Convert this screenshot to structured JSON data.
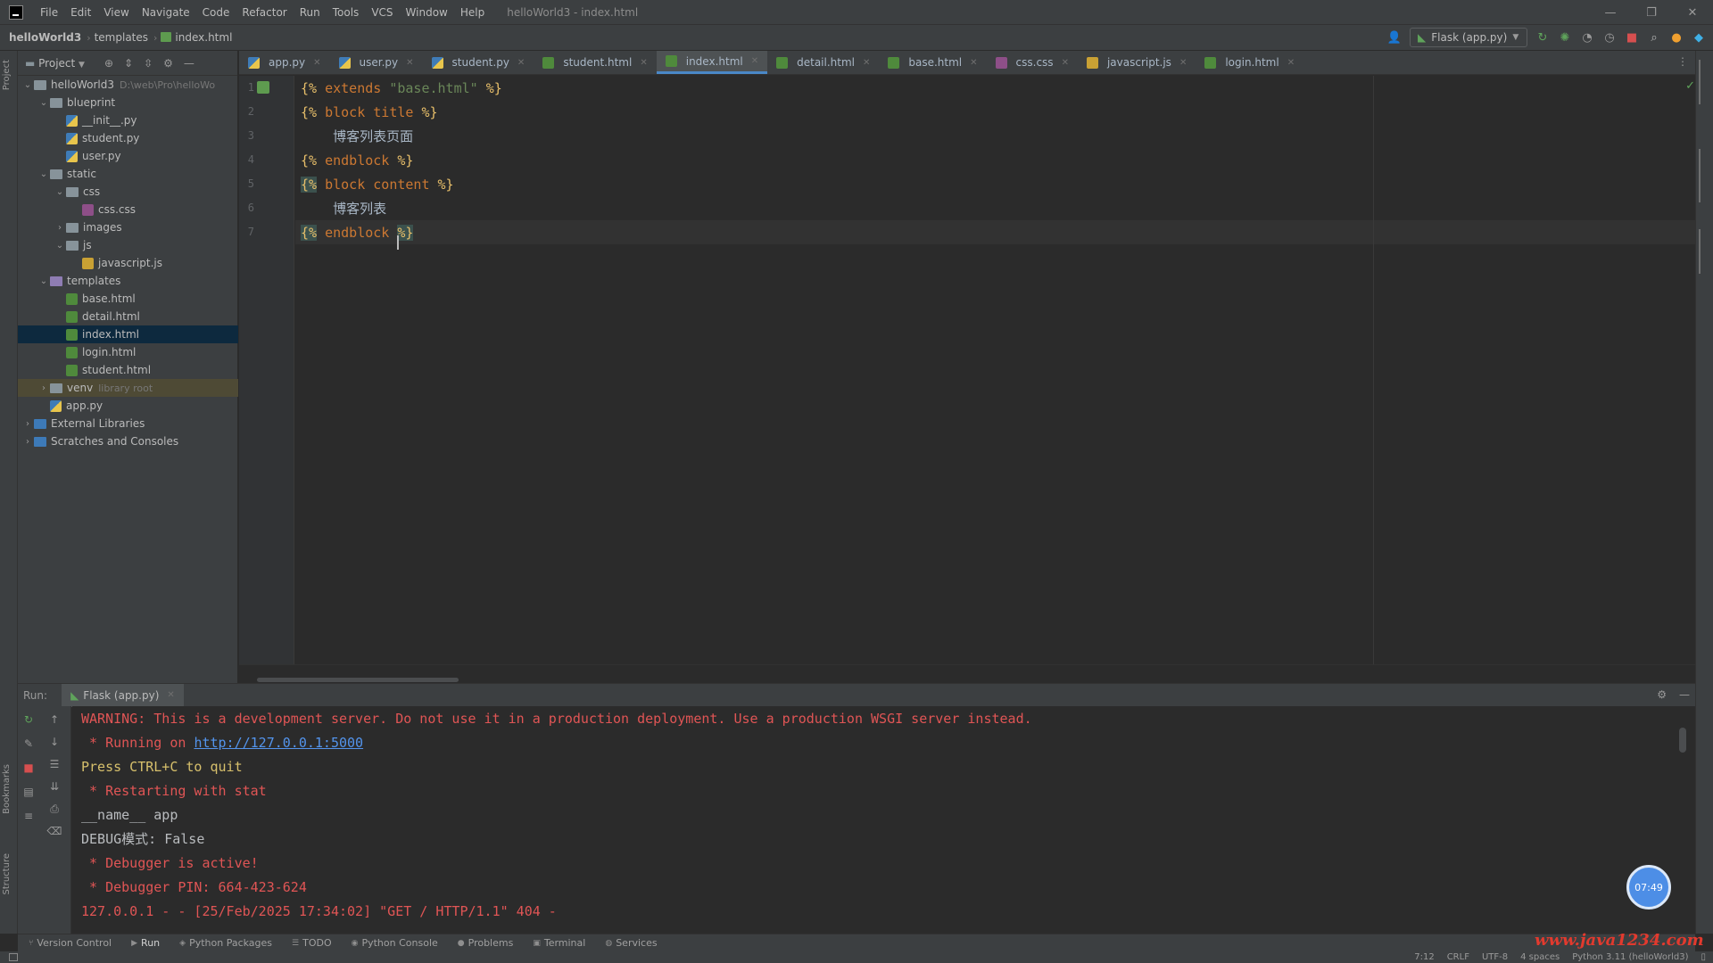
{
  "window": {
    "menu": [
      "File",
      "Edit",
      "View",
      "Navigate",
      "Code",
      "Refactor",
      "Run",
      "Tools",
      "VCS",
      "Window",
      "Help"
    ],
    "title": "helloWorld3 - index.html",
    "controls": [
      "—",
      "❐",
      "✕"
    ]
  },
  "navbar": {
    "breadcrumbs": [
      "helloWorld3",
      "templates",
      "index.html"
    ],
    "run_config": "Flask (app.py)"
  },
  "left_strip": {
    "labels": [
      "Project",
      "Bookmarks",
      "Structure"
    ]
  },
  "project": {
    "title": "Project",
    "tree": [
      {
        "label": "helloWorld3",
        "hint": "D:\\web\\Pro\\helloWo",
        "type": "folder",
        "level": 0,
        "open": true
      },
      {
        "label": "blueprint",
        "type": "folder",
        "level": 1,
        "open": true
      },
      {
        "label": "__init__.py",
        "type": "py",
        "level": 2
      },
      {
        "label": "student.py",
        "type": "py",
        "level": 2
      },
      {
        "label": "user.py",
        "type": "py",
        "level": 2
      },
      {
        "label": "static",
        "type": "folder",
        "level": 1,
        "open": true
      },
      {
        "label": "css",
        "type": "folder",
        "level": 2,
        "open": true
      },
      {
        "label": "css.css",
        "type": "css",
        "level": 3
      },
      {
        "label": "images",
        "type": "folder",
        "level": 2,
        "open": false
      },
      {
        "label": "js",
        "type": "folder",
        "level": 2,
        "open": true
      },
      {
        "label": "javascript.js",
        "type": "js",
        "level": 3
      },
      {
        "label": "templates",
        "type": "folder-purple",
        "level": 1,
        "open": true
      },
      {
        "label": "base.html",
        "type": "html",
        "level": 2
      },
      {
        "label": "detail.html",
        "type": "html",
        "level": 2
      },
      {
        "label": "index.html",
        "type": "html",
        "level": 2,
        "selected": true
      },
      {
        "label": "login.html",
        "type": "html",
        "level": 2
      },
      {
        "label": "student.html",
        "type": "html",
        "level": 2
      },
      {
        "label": "venv",
        "hint": "library root",
        "type": "folder",
        "level": 1,
        "open": false,
        "highlight": true
      },
      {
        "label": "app.py",
        "type": "py",
        "level": 1
      },
      {
        "label": "External Libraries",
        "type": "folder-blue",
        "level": 0,
        "open": false
      },
      {
        "label": "Scratches and Consoles",
        "type": "folder-blue",
        "level": 0,
        "open": false
      }
    ]
  },
  "tabs": [
    {
      "label": "app.py",
      "type": "py"
    },
    {
      "label": "user.py",
      "type": "py"
    },
    {
      "label": "student.py",
      "type": "py"
    },
    {
      "label": "student.html",
      "type": "html"
    },
    {
      "label": "index.html",
      "type": "html",
      "active": true
    },
    {
      "label": "detail.html",
      "type": "html"
    },
    {
      "label": "base.html",
      "type": "html"
    },
    {
      "label": "css.css",
      "type": "css"
    },
    {
      "label": "javascript.js",
      "type": "js"
    },
    {
      "label": "login.html",
      "type": "html"
    }
  ],
  "editor": {
    "lines": [
      {
        "no": "1",
        "open": "{%",
        "kw": " extends ",
        "str": "\"base.html\"",
        "close": " %}"
      },
      {
        "no": "2",
        "open": "{%",
        "kw": " block title ",
        "str": "",
        "close": "%}"
      },
      {
        "no": "3",
        "text": "    博客列表页面"
      },
      {
        "no": "4",
        "open": "{%",
        "kw": " endblock ",
        "str": "",
        "close": "%}"
      },
      {
        "no": "5",
        "open": "{%",
        "kw": " block content ",
        "str": "",
        "close": "%}"
      },
      {
        "no": "6",
        "text": "    博客列表"
      },
      {
        "no": "7",
        "open": "{%",
        "kw": " endblock ",
        "str": "",
        "close": "%}"
      }
    ]
  },
  "run_panel": {
    "label": "Run:",
    "tab": "Flask (app.py)",
    "console": [
      {
        "parts": [
          {
            "t": "WARNING: This is a development server. Do not use it in a production deployment. Use a production WSGI server instead.",
            "c": "red"
          }
        ]
      },
      {
        "parts": [
          {
            "t": " * Running on ",
            "c": "red"
          },
          {
            "t": "http://127.0.0.1:5000",
            "c": "link"
          }
        ]
      },
      {
        "parts": [
          {
            "t": "Press CTRL+C to quit",
            "c": "yellow"
          }
        ]
      },
      {
        "parts": [
          {
            "t": " * Restarting with stat",
            "c": "red"
          }
        ]
      },
      {
        "parts": [
          {
            "t": "__name__ app",
            "c": "plain"
          }
        ]
      },
      {
        "parts": [
          {
            "t": "DEBUG模式: False",
            "c": "plain"
          }
        ]
      },
      {
        "parts": [
          {
            "t": " * Debugger is active!",
            "c": "red"
          }
        ]
      },
      {
        "parts": [
          {
            "t": " * Debugger PIN: 664-423-624",
            "c": "red"
          }
        ]
      },
      {
        "parts": [
          {
            "t": "127.0.0.1 - - [25/Feb/2025 17:34:02] \"GET / HTTP/1.1\" 404 -",
            "c": "red"
          }
        ]
      }
    ],
    "timer": "07:49"
  },
  "bottom_bar": [
    {
      "label": "Version Control",
      "icon": "⑂"
    },
    {
      "label": "Run",
      "icon": "▶",
      "active": true
    },
    {
      "label": "Python Packages",
      "icon": "◈"
    },
    {
      "label": "TODO",
      "icon": "☰"
    },
    {
      "label": "Python Console",
      "icon": "◉"
    },
    {
      "label": "Problems",
      "icon": "●"
    },
    {
      "label": "Terminal",
      "icon": "▣"
    },
    {
      "label": "Services",
      "icon": "◍"
    }
  ],
  "status_bar": {
    "position": "7:12",
    "line_sep": "CRLF",
    "encoding": "UTF-8",
    "indent": "4 spaces",
    "interpreter": "Python 3.11 (helloWorld3)"
  },
  "watermark": "www.java1234.com"
}
